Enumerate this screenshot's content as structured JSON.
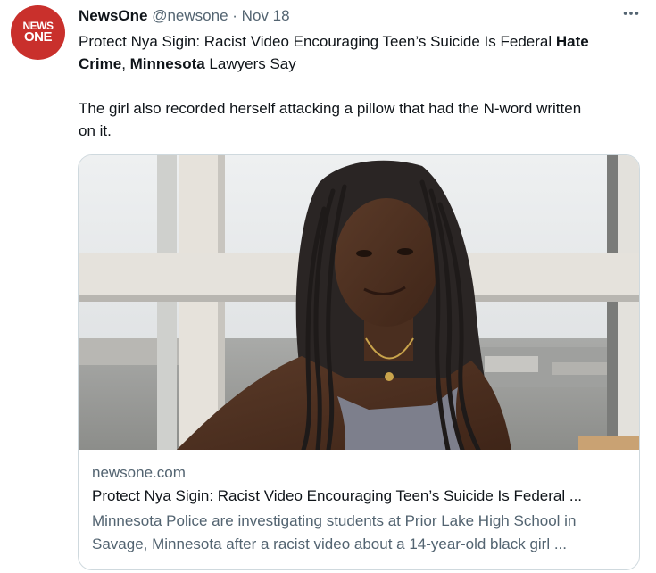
{
  "tweet": {
    "avatar": {
      "line1": "NEWS",
      "line2": "ONE"
    },
    "author_name": "NewsOne",
    "handle": "@newsone",
    "separator": "·",
    "date": "Nov 18",
    "more_icon": "more-dots-icon",
    "headline_part1": "Protect Nya Sigin: Racist Video Encouraging Teen’s Suicide Is Federal ",
    "headline_bold1": "Hate",
    "headline_line2_bold": "Crime",
    "headline_comma": ", ",
    "headline_bold2": "Minnesota",
    "headline_end": " Lawyers Say",
    "body_line1": "The girl also recorded herself attacking a pillow that had the N-word written",
    "body_line2": "on it."
  },
  "card": {
    "domain": "newsone.com",
    "title": "Protect Nya Sigin: Racist Video Encouraging Teen’s Suicide Is Federal ...",
    "desc_line1": "Minnesota Police are investigating students at Prior Lake High School in",
    "desc_line2": "Savage, Minnesota after a racist video about a 14-year-old black girl ..."
  }
}
